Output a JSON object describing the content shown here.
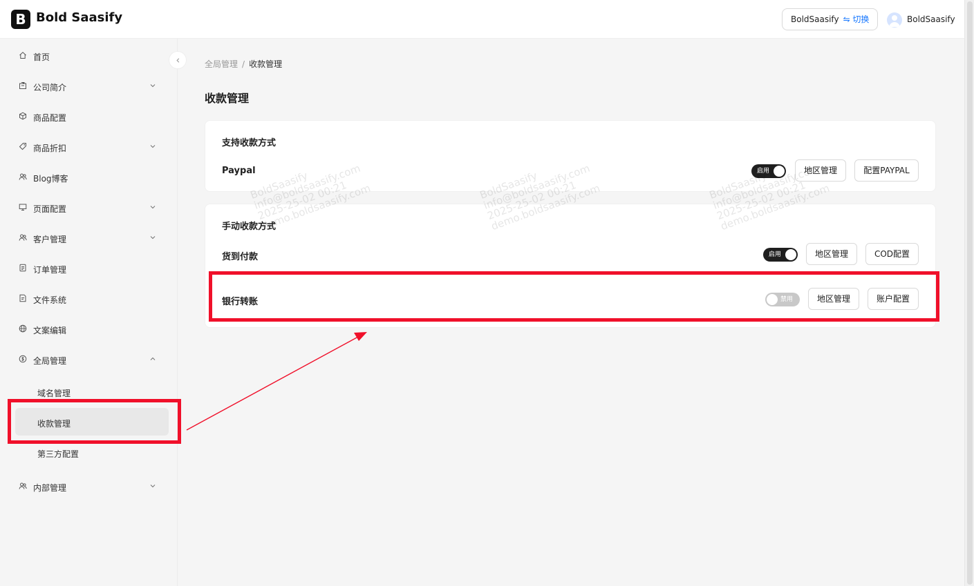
{
  "header": {
    "logo_letter": "B",
    "app_name": "Bold Saasify",
    "switch_label": "BoldSaasify",
    "switch_link": "⇋ 切换",
    "user_name": "BoldSaasify"
  },
  "sidebar": {
    "items": [
      {
        "label": "首页"
      },
      {
        "label": "公司简介"
      },
      {
        "label": "商品配置"
      },
      {
        "label": "商品折扣"
      },
      {
        "label": "Blog博客"
      },
      {
        "label": "页面配置"
      },
      {
        "label": "客户管理"
      },
      {
        "label": "订单管理"
      },
      {
        "label": "文件系统"
      },
      {
        "label": "文案编辑"
      },
      {
        "label": "全局管理"
      },
      {
        "label": "内部管理"
      }
    ],
    "sub_items": [
      {
        "label": "域名管理"
      },
      {
        "label": "收款管理"
      },
      {
        "label": "第三方配置"
      }
    ]
  },
  "breadcrumb": {
    "parent": "全局管理",
    "separator": "/",
    "current": "收款管理"
  },
  "page_title": "收款管理",
  "supported": {
    "title": "支持收款方式",
    "method": "Paypal",
    "toggle": "启用",
    "btn_region": "地区管理",
    "btn_config": "配置PAYPAL"
  },
  "manual": {
    "title": "手动收款方式",
    "cod": {
      "name": "货到付款",
      "toggle": "启用",
      "btn_region": "地区管理",
      "btn_config": "COD配置"
    },
    "bank": {
      "name": "银行转账",
      "toggle": "禁用",
      "btn_region": "地区管理",
      "btn_config": "账户配置"
    }
  },
  "watermark": {
    "line1": "BoldSaasify",
    "line2": "info@boldsaasify.com",
    "line3": "2025-25-02 00:21",
    "line4": "demo.boldsaasify.com"
  },
  "colors": {
    "annotation_red": "#f0102a",
    "primary_dark": "#1f1f1f",
    "link_blue": "#1677ff"
  }
}
